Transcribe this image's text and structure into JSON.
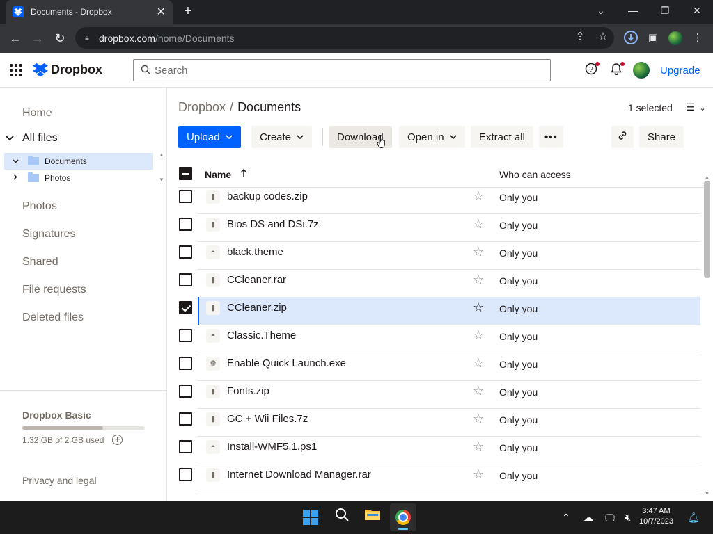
{
  "browser": {
    "tab_title": "Documents - Dropbox",
    "url_host": "dropbox.com",
    "url_path": "/home/Documents"
  },
  "header": {
    "logo_text": "Dropbox",
    "search_placeholder": "Search",
    "upgrade_label": "Upgrade"
  },
  "sidebar": {
    "home": "Home",
    "all_files": "All files",
    "tree": [
      {
        "label": "Documents",
        "selected": true
      },
      {
        "label": "Photos",
        "selected": false
      }
    ],
    "links": [
      "Photos",
      "Signatures",
      "Shared",
      "File requests",
      "Deleted files"
    ],
    "plan_name": "Dropbox Basic",
    "quota_text": "1.32 GB of 2 GB used",
    "quota_fraction": 0.66,
    "privacy": "Privacy and legal"
  },
  "main": {
    "breadcrumb_parent": "Dropbox",
    "breadcrumb_sep": "/",
    "breadcrumb_current": "Documents",
    "selected_count": "1 selected",
    "toolbar": {
      "upload": "Upload",
      "create": "Create",
      "download": "Download",
      "open_in": "Open in",
      "extract_all": "Extract all",
      "share": "Share"
    },
    "columns": {
      "name": "Name",
      "access": "Who can access"
    },
    "files": [
      {
        "name": "backup codes.zip",
        "access": "Only you",
        "icon": "zip-icon",
        "selected": false
      },
      {
        "name": "Bios DS and DSi.7z",
        "access": "Only you",
        "icon": "zip-icon",
        "selected": false
      },
      {
        "name": "black.theme",
        "access": "Only you",
        "icon": "theme-icon",
        "selected": false
      },
      {
        "name": "CCleaner.rar",
        "access": "Only you",
        "icon": "zip-icon",
        "selected": false
      },
      {
        "name": "CCleaner.zip",
        "access": "Only you",
        "icon": "zip-icon",
        "selected": true
      },
      {
        "name": "Classic.Theme",
        "access": "Only you",
        "icon": "theme-icon",
        "selected": false
      },
      {
        "name": "Enable Quick Launch.exe",
        "access": "Only you",
        "icon": "exe-icon",
        "selected": false
      },
      {
        "name": "Fonts.zip",
        "access": "Only you",
        "icon": "zip-icon",
        "selected": false
      },
      {
        "name": "GC + Wii Files.7z",
        "access": "Only you",
        "icon": "zip-icon",
        "selected": false
      },
      {
        "name": "Install-WMF5.1.ps1",
        "access": "Only you",
        "icon": "theme-icon",
        "selected": false
      },
      {
        "name": "Internet Download Manager.rar",
        "access": "Only you",
        "icon": "zip-icon",
        "selected": false
      }
    ]
  },
  "taskbar": {
    "time": "3:47 AM",
    "date": "10/7/2023"
  },
  "colors": {
    "accent": "#0061fe",
    "selected_row": "#dce8fc"
  }
}
